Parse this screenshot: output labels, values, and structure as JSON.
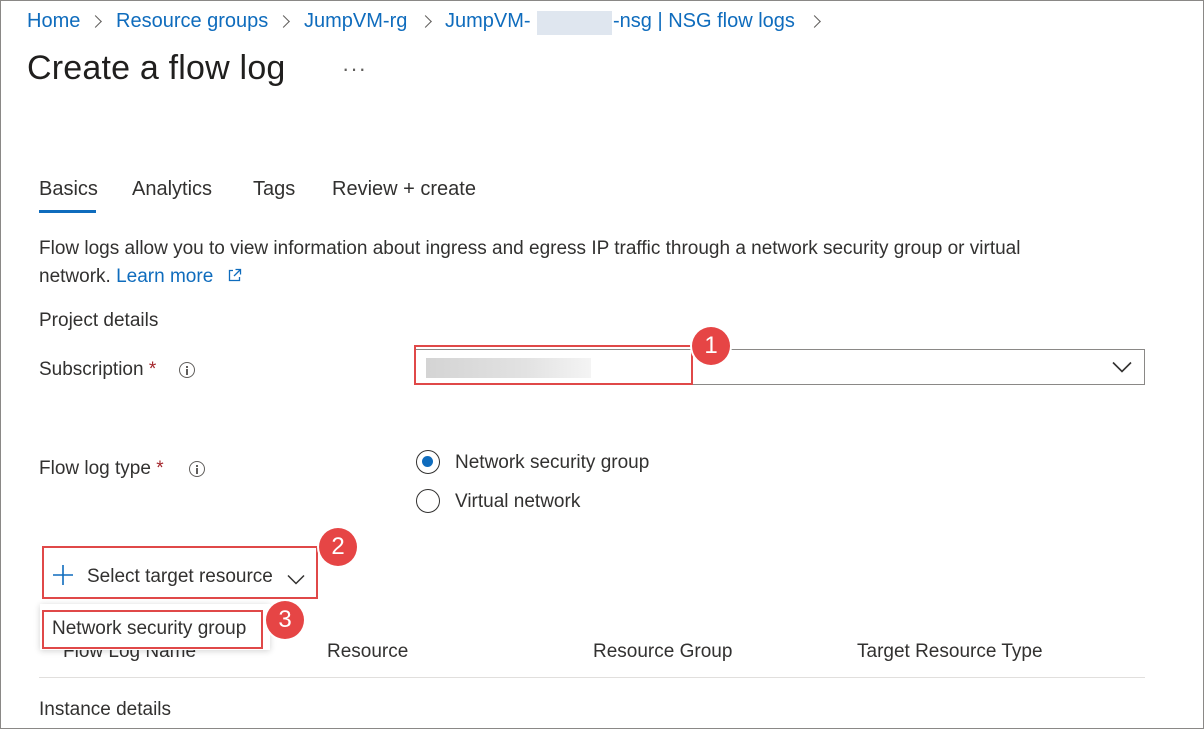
{
  "breadcrumb": {
    "items": [
      "Home",
      "Resource groups",
      "JumpVM-rg",
      "JumpVM-",
      "-nsg | NSG flow logs"
    ]
  },
  "page": {
    "title": "Create a flow log",
    "more": "···"
  },
  "tabs": [
    "Basics",
    "Analytics",
    "Tags",
    "Review + create"
  ],
  "intro": {
    "line1": "Flow logs allow you to view information about ingress and egress IP traffic through a network security group or virtual",
    "line2": "network.",
    "learn_more": "Learn more"
  },
  "project_details": {
    "heading": "Project details",
    "subscription_label": "Subscription",
    "required_mark": "*",
    "subscription_value": ""
  },
  "flow_log_type": {
    "label": "Flow log type",
    "required_mark": "*",
    "options": [
      "Network security group",
      "Virtual network"
    ],
    "selected": "Network security group"
  },
  "target": {
    "button_label": "Select target resource",
    "menu_item": "Network security group"
  },
  "table": {
    "columns": [
      "Flow Log Name",
      "Resource",
      "Resource Group",
      "Target Resource Type"
    ]
  },
  "instance_details": {
    "heading": "Instance details"
  },
  "callouts": [
    "1",
    "2",
    "3"
  ],
  "colors": {
    "link": "#0f6cbd",
    "callout": "#e64545",
    "accent": "#0f6cbd"
  }
}
